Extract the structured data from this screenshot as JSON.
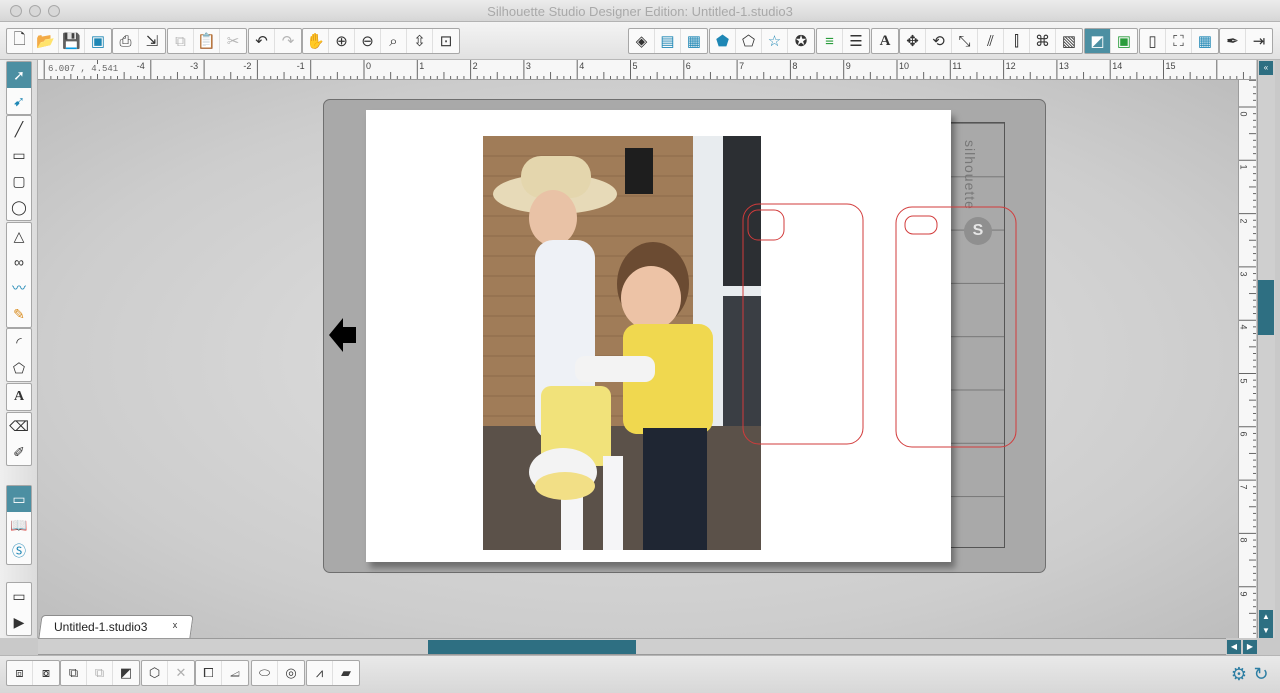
{
  "window": {
    "title": "Silhouette Studio Designer Edition: Untitled-1.studio3"
  },
  "toolbar": {
    "file_group": [
      "new-document-icon",
      "open-icon",
      "save-icon",
      "save-to-library-icon"
    ],
    "print_group": [
      "print-icon",
      "send-to-silhouette-icon"
    ],
    "edit_group": [
      "copy-icon",
      "paste-icon",
      "cut-icon"
    ],
    "undo_group": [
      "undo-icon",
      "redo-icon"
    ],
    "view_group": [
      "pan-icon",
      "zoom-in-icon",
      "zoom-out-icon",
      "zoom-select-icon",
      "fit-to-window-icon",
      "zoom-to-page-icon"
    ],
    "text_glyph": "A"
  },
  "ruler": {
    "coordinate_readout": "6.007 , 4.541",
    "h_labels": [
      "-4",
      "-3",
      "-2",
      "-1",
      "0",
      "1",
      "2",
      "3",
      "4",
      "5",
      "6",
      "7",
      "8",
      "9",
      "10",
      "11",
      "12",
      "13",
      "14",
      "15"
    ],
    "v_labels": [
      "0",
      "1",
      "2",
      "3",
      "4",
      "5",
      "6",
      "7",
      "8",
      "9"
    ]
  },
  "mat": {
    "brand_text": "silhouette",
    "logo_letter": "S"
  },
  "tabs": [
    {
      "label": "Untitled-1.studio3",
      "close": "x"
    }
  ],
  "left_tools": {
    "text_tool_glyph": "A"
  },
  "colors": {
    "accent": "#2e6f82",
    "active_button": "#4c8fa2",
    "cut_line": "#d23b3b",
    "mat": "#a9a9a9"
  }
}
